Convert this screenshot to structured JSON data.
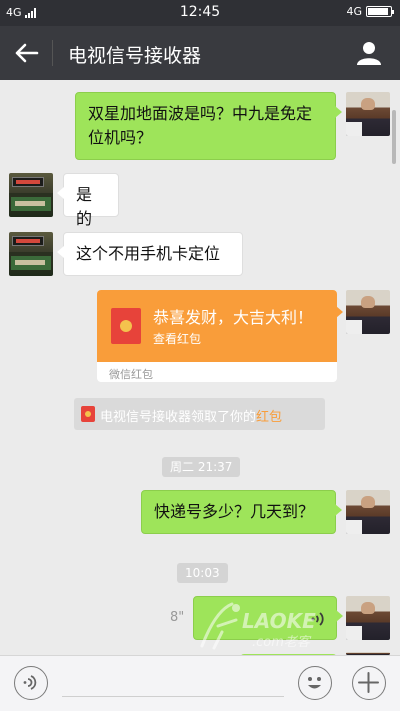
{
  "status_bar": {
    "network": "4G",
    "time": "12:45",
    "network_right": "4G"
  },
  "header": {
    "title": "电视信号接收器",
    "back_icon": "arrow-left-icon",
    "profile_icon": "person-icon"
  },
  "messages": [
    {
      "from": "me",
      "text": "双星加地面波是吗？中九是免定位机吗？"
    },
    {
      "from": "them",
      "text": "是的"
    },
    {
      "from": "them",
      "text": "这个不用手机卡定位"
    }
  ],
  "red_packet": {
    "greeting": "恭喜发财，大吉大利！",
    "action": "查看红包",
    "footer": "微信红包"
  },
  "system_notice": {
    "prefix": "电视信号接收器领取了你的",
    "highlight": "红包"
  },
  "timestamp_1": "周二 21:37",
  "message_after_1": "快递号多少？几天到？",
  "timestamp_2": "10:03",
  "voice_message": {
    "duration": "8\""
  },
  "watermark": {
    "brand": "LAOKE",
    "sub": ".com老客"
  },
  "input_bar": {
    "voice_icon": "voice-input-icon",
    "emoji_icon": "emoji-icon",
    "plus_icon": "plus-icon"
  },
  "colors": {
    "my_bubble": "#9ee45a",
    "red_packet": "#f99d3a",
    "header": "#393a3f"
  }
}
